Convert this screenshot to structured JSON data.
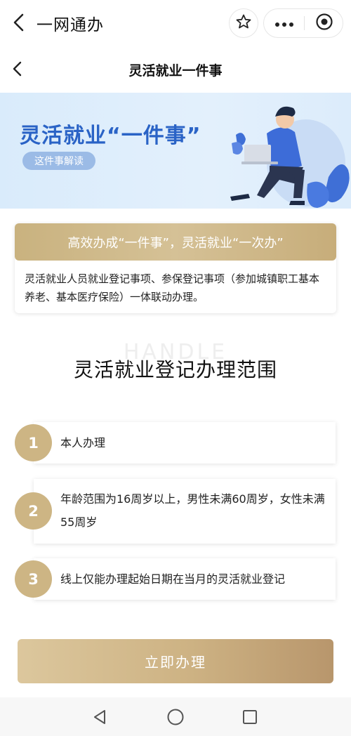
{
  "topbar": {
    "title": "一网通办",
    "icons": [
      "back-arrow-icon",
      "star-icon",
      "more-icon",
      "close-circle-icon"
    ]
  },
  "header": {
    "title": "灵活就业一件事"
  },
  "banner": {
    "title": "灵活就业“一件事”",
    "pill_label": "这件事解读"
  },
  "intro": {
    "heading": "高效办成“一件事”，灵活就业“一次办”",
    "body": "灵活就业人员就业登记事项、参保登记事项（参加城镇职工基本养老、基本医疗保险）一体联动办理。"
  },
  "section": {
    "watermark": "HANDLE",
    "title": "灵活就业登记办理范围"
  },
  "steps": [
    {
      "number": "1",
      "text": "本人办理"
    },
    {
      "number": "2",
      "text": "年龄范围为16周岁以上，男性未满60周岁，女性未满55周岁"
    },
    {
      "number": "3",
      "text": "线上仅能办理起始日期在当月的灵活就业登记"
    }
  ],
  "actions": {
    "submit_label": "立即办理"
  },
  "colors": {
    "gold": "#cdb584",
    "banner_blue": "#2a63c6",
    "banner_bg": "#dcecfb"
  }
}
